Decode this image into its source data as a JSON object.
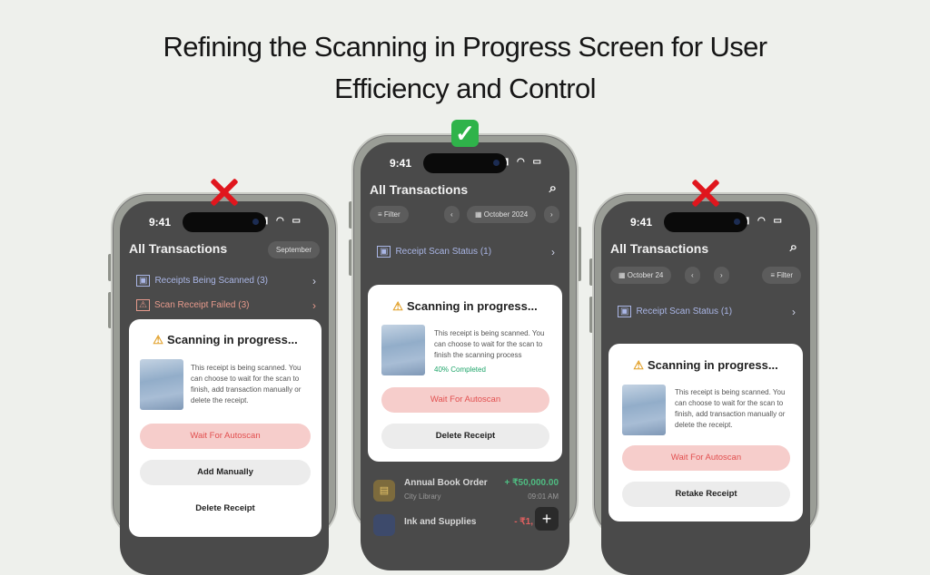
{
  "headline": {
    "line1": "Refining the Scanning in Progress Screen for User",
    "line2": "Efficiency and Control"
  },
  "status_bar": {
    "time": "9:41"
  },
  "phones": {
    "left": {
      "verdict": "wrong",
      "header_title": "All Transactions",
      "month_pill": "September",
      "rows": [
        "Receipts Being Scanned (3)",
        "Scan Receipt Failed (3)"
      ],
      "sheet": {
        "title": "Scanning in progress...",
        "description": "This receipt is being scanned. You can choose to wait for the scan to finish, add transaction manually or delete the receipt.",
        "buttons": [
          "Wait For Autoscan",
          "Add Manually",
          "Delete Receipt"
        ]
      }
    },
    "center": {
      "verdict": "correct",
      "header_title": "All Transactions",
      "filter_label": "Filter",
      "month_pill": "October 2024",
      "row": "Receipt Scan Status (1)",
      "sheet": {
        "title": "Scanning in progress...",
        "description": "This receipt is being scanned. You can choose to wait for the scan to finish the scanning process",
        "progress_label": "40% Completed",
        "progress_value": 0.4,
        "buttons": [
          "Wait For Autoscan",
          "Delete Receipt"
        ]
      },
      "transactions": [
        {
          "name": "Annual Book Order",
          "merchant": "City Library",
          "amount": "+ ₹50,000.00",
          "time": "09:01 AM"
        },
        {
          "name": "Ink and Supplies",
          "amount": "- ₹1,"
        }
      ]
    },
    "right": {
      "verdict": "wrong",
      "header_title": "All Transactions",
      "month_pill": "October 24",
      "filter_label": "Filter",
      "row": "Receipt Scan Status (1)",
      "sheet": {
        "title": "Scanning in progress...",
        "description": "This receipt is being scanned. You can choose to wait for the scan to finish, add transaction manually or delete the receipt.",
        "buttons": [
          "Wait For Autoscan",
          "Retake Receipt"
        ]
      }
    }
  },
  "colors": {
    "background": "#eef0ec",
    "wrong_mark": "#e0161d",
    "correct_mark": "#2fb34a",
    "primary_button_bg": "#f6cdcb",
    "primary_button_text": "#e25050",
    "progress_text": "#1fa56a",
    "warning_icon": "#e2a12b"
  },
  "icons": [
    "x-mark-icon",
    "check-mark-icon",
    "warning-icon",
    "search-icon",
    "filter-icon",
    "calendar-icon",
    "scan-icon",
    "chevron-right-icon",
    "chevron-left-icon",
    "plus-icon"
  ]
}
